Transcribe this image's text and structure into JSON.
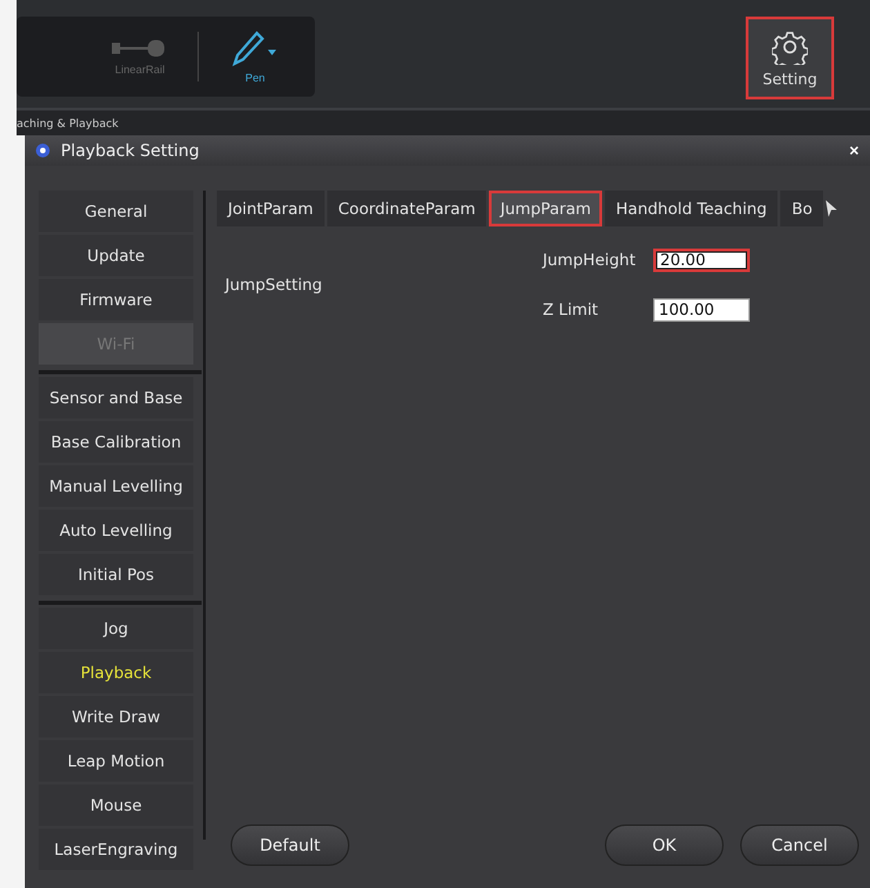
{
  "toolbar": {
    "tools": [
      {
        "kind": "linear-rail",
        "label": "LinearRail",
        "active": false
      },
      {
        "kind": "pen",
        "label": "Pen",
        "active": true
      }
    ],
    "setting_button": {
      "label": "Setting",
      "highlighted": true
    }
  },
  "breadcrumb": "aching & Playback",
  "dialog": {
    "title": "Playback Setting",
    "close": "×",
    "nav_groups": [
      [
        {
          "label": "General",
          "selected": false,
          "disabled": false
        },
        {
          "label": "Update",
          "selected": false,
          "disabled": false
        },
        {
          "label": "Firmware",
          "selected": false,
          "disabled": false
        },
        {
          "label": "Wi-Fi",
          "selected": false,
          "disabled": true
        }
      ],
      [
        {
          "label": "Sensor and Base",
          "selected": false,
          "disabled": false
        },
        {
          "label": "Base Calibration",
          "selected": false,
          "disabled": false
        },
        {
          "label": "Manual Levelling",
          "selected": false,
          "disabled": false
        },
        {
          "label": "Auto Levelling",
          "selected": false,
          "disabled": false
        },
        {
          "label": "Initial Pos",
          "selected": false,
          "disabled": false
        }
      ],
      [
        {
          "label": "Jog",
          "selected": false,
          "disabled": false
        },
        {
          "label": "Playback",
          "selected": true,
          "disabled": false
        },
        {
          "label": "Write  Draw",
          "selected": false,
          "disabled": false
        },
        {
          "label": "Leap Motion",
          "selected": false,
          "disabled": false
        },
        {
          "label": "Mouse",
          "selected": false,
          "disabled": false
        },
        {
          "label": "LaserEngraving",
          "selected": false,
          "disabled": false
        }
      ]
    ],
    "tabs": [
      {
        "label": "JointParam",
        "selected": false,
        "highlighted": false
      },
      {
        "label": "CoordinateParam",
        "selected": false,
        "highlighted": false
      },
      {
        "label": "JumpParam",
        "selected": true,
        "highlighted": true
      },
      {
        "label": "Handhold Teaching",
        "selected": false,
        "highlighted": false
      },
      {
        "label": "Bo",
        "selected": false,
        "highlighted": false
      }
    ],
    "section_label": "JumpSetting",
    "fields": [
      {
        "label": "JumpHeight",
        "value": "20.00",
        "highlighted": true
      },
      {
        "label": "Z Limit",
        "value": "100.00",
        "highlighted": false
      }
    ],
    "buttons": {
      "default": "Default",
      "ok": "OK",
      "cancel": "Cancel"
    }
  }
}
